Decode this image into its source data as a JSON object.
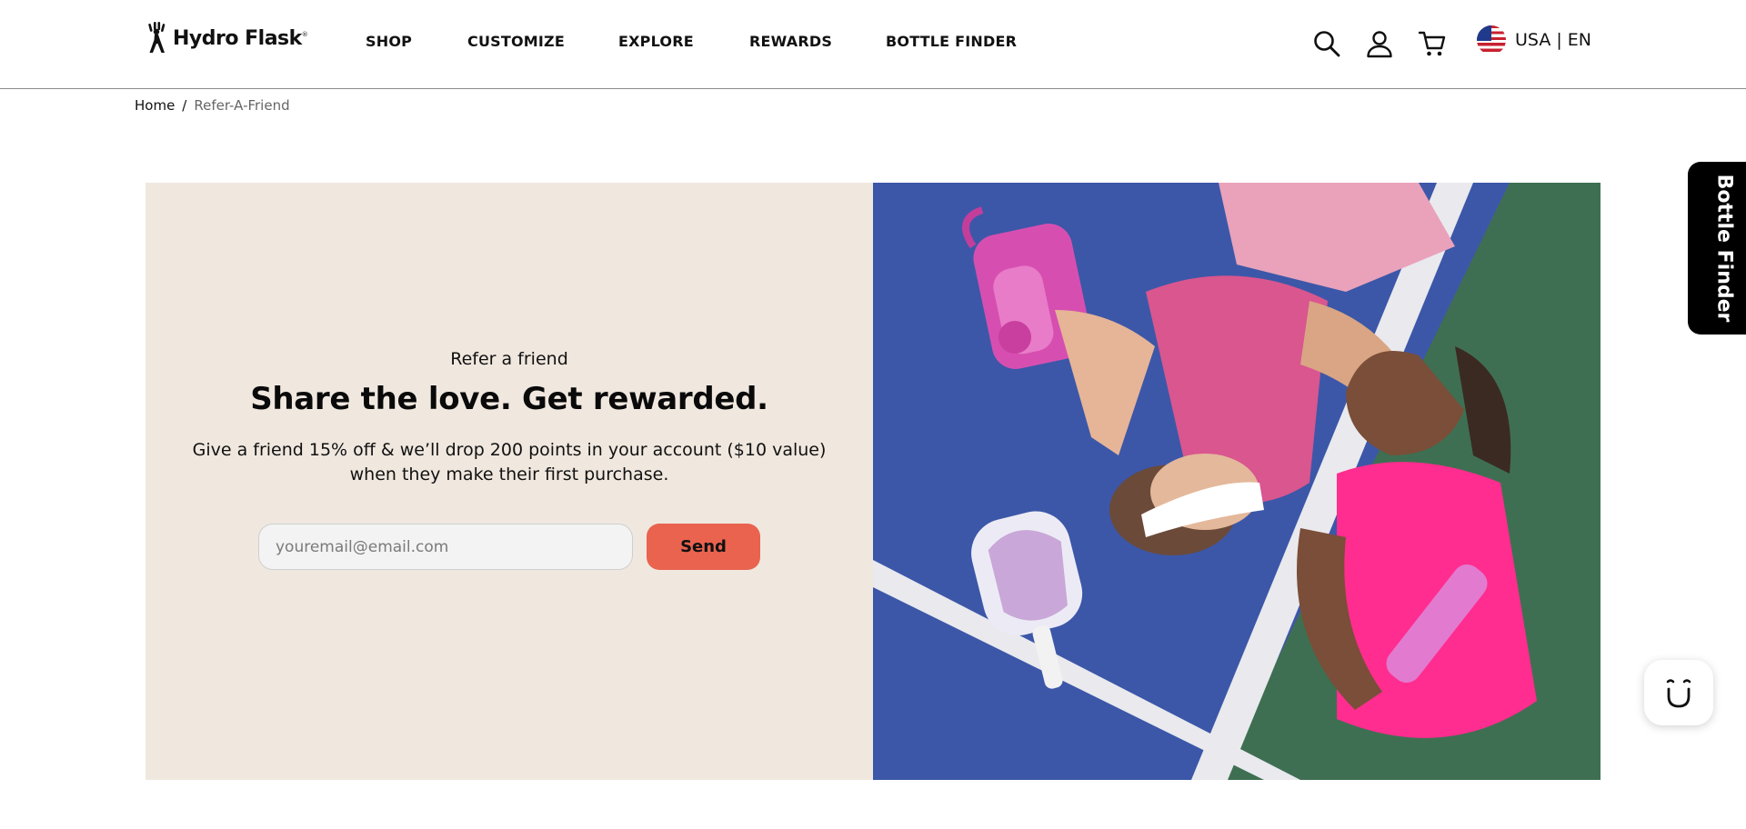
{
  "header": {
    "brand": "Hydro Flask",
    "nav": [
      {
        "label": "SHOP"
      },
      {
        "label": "CUSTOMIZE"
      },
      {
        "label": "EXPLORE"
      },
      {
        "label": "REWARDS"
      },
      {
        "label": "BOTTLE FINDER"
      }
    ],
    "icons": [
      "search-icon",
      "account-icon",
      "cart-icon"
    ],
    "locale": {
      "flag": "us-flag-icon",
      "label": "USA | EN"
    }
  },
  "breadcrumb": {
    "home": "Home",
    "separator": "/",
    "current": "Refer-A-Friend"
  },
  "hero": {
    "eyebrow": "Refer a friend",
    "headline": "Share the love. Get rewarded.",
    "body": "Give a friend 15% off & we’ll drop 200 points in your account ($10 value) when they make their first purchase.",
    "email_placeholder": "youremail@email.com",
    "email_value": "",
    "send_label": "Send",
    "accent_color": "#e9634f",
    "panel_color": "#f0e8df"
  },
  "side_tab": {
    "label": "Bottle Finder"
  },
  "widget": {
    "icon": "smiley-face-icon"
  }
}
